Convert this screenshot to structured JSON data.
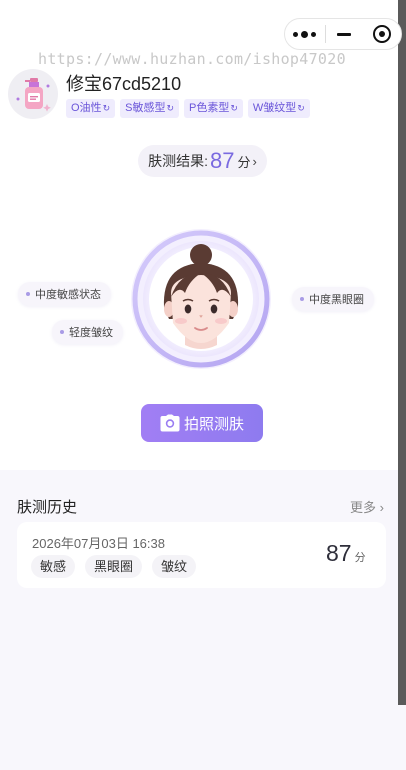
{
  "watermark": "https://www.huzhan.com/ishop47020",
  "user": {
    "name": "修宝67cd5210",
    "avatar": "lotion-bottle-icon"
  },
  "skin_types": [
    {
      "label": "O油性",
      "refresh": "↻"
    },
    {
      "label": "S敏感型",
      "refresh": "↻"
    },
    {
      "label": "P色素型",
      "refresh": "↻"
    },
    {
      "label": "W皱纹型",
      "refresh": "↻"
    }
  ],
  "result": {
    "label": "肤测结果:",
    "score": "87",
    "unit": "分",
    "arrow": "›"
  },
  "chips": {
    "left_top": "中度敏感状态",
    "left_bottom": "轻度皱纹",
    "right": "中度黑眼圈"
  },
  "photo_button": {
    "label": "拍照测肤",
    "icon": "camera-icon"
  },
  "history": {
    "title": "肤测历史",
    "more": "更多 ›",
    "records": [
      {
        "date": "2026年07月03日 16:38",
        "tags": [
          "敏感",
          "黑眼圈",
          "皱纹"
        ],
        "score": "87",
        "unit": "分"
      }
    ]
  },
  "colors": {
    "accent": "#7a6ae0",
    "button_start": "#a17ef4",
    "button_end": "#8e7bef",
    "tag_bg": "#efecfd"
  }
}
